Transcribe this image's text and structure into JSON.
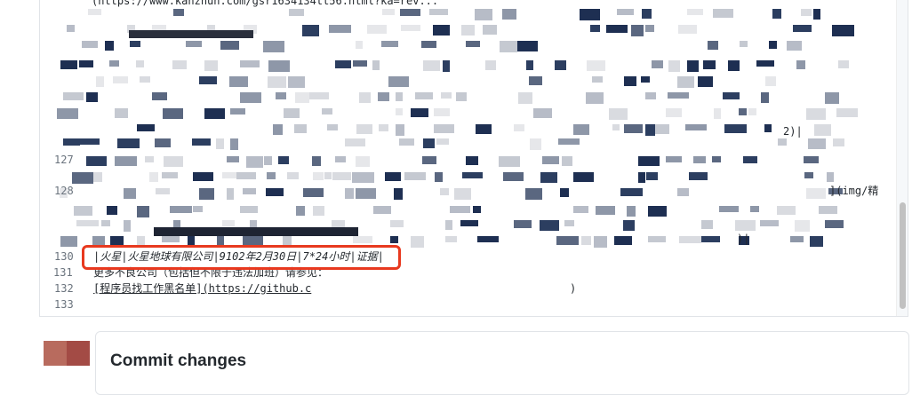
{
  "editor": {
    "lines": [
      {
        "num": "127",
        "text": ""
      },
      {
        "num": "128",
        "text": ""
      },
      {
        "num": "129",
        "text": ""
      },
      {
        "num": "130",
        "text": "|火星|火星地球有限公司|9102年2月30日|7*24小时|证据|"
      },
      {
        "num": "131",
        "text": "更多不良公司（包括但不限于违法加班）请参见："
      },
      {
        "num": "132",
        "text": "[程序员找工作黑名单](https://github.c"
      },
      {
        "num": "133",
        "text": ""
      }
    ],
    "top_line_text": "(https://www.kanzhun.com/gsr1634134tt56.html?ka=rev...",
    "line_128_tail": "](img/精",
    "line_127_tail": "2)|",
    "line_130_tail": ")|",
    "line_132_tail": ")"
  },
  "commit": {
    "title": "Commit changes"
  },
  "colors": {
    "highlight_border": "#e8391f",
    "avatar_left": "#b86b5e",
    "avatar_right": "#a34b45"
  }
}
